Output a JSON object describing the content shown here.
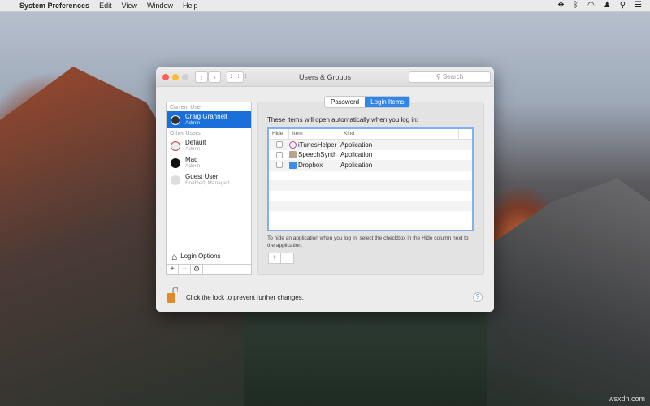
{
  "menubar": {
    "app": "System Preferences",
    "items": [
      "Edit",
      "View",
      "Window",
      "Help"
    ]
  },
  "window": {
    "title": "Users & Groups",
    "search_placeholder": "Search"
  },
  "sidebar": {
    "current_header": "Current User",
    "other_header": "Other Users",
    "current": {
      "name": "Craig Grannell",
      "role": "Admin"
    },
    "others": [
      {
        "name": "Default",
        "role": "Admin"
      },
      {
        "name": "Mac",
        "role": "Admin"
      },
      {
        "name": "Guest User",
        "role": "Enabled, Managed"
      }
    ],
    "login_options": "Login Options"
  },
  "tabs": [
    "Password",
    "Login Items"
  ],
  "login_items": {
    "intro": "These items will open automatically when you log in:",
    "columns": [
      "Hide",
      "Item",
      "Kind"
    ],
    "rows": [
      {
        "item": "iTunesHelper",
        "kind": "Application"
      },
      {
        "item": "SpeechSynth",
        "kind": "Application"
      },
      {
        "item": "Dropbox",
        "kind": "Application"
      }
    ],
    "hint": "To hide an application when you log in, select the checkbox in the Hide column next to the application."
  },
  "footer": {
    "lock_text": "Click the lock to prevent further changes.",
    "help": "?"
  },
  "watermark": "wsxdn.com",
  "colors": {
    "accent": "#2f86ee",
    "selection": "#1a6fd8"
  }
}
